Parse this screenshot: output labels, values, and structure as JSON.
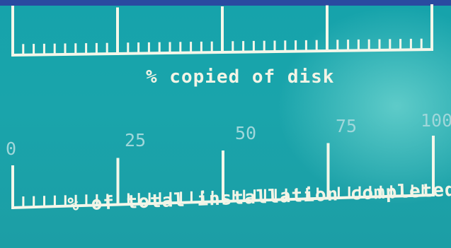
{
  "disk_gauge": {
    "caption": "% copied of disk"
  },
  "total_gauge": {
    "caption": "% of total installation completed",
    "scale_labels": [
      "0",
      "25",
      "50",
      "75",
      "100"
    ]
  },
  "colors": {
    "background": "#1a9fa6",
    "gauge_lines": "#f4f7ea",
    "scale_labels": "#9fd7da",
    "top_strip": "#2a4aa0"
  }
}
